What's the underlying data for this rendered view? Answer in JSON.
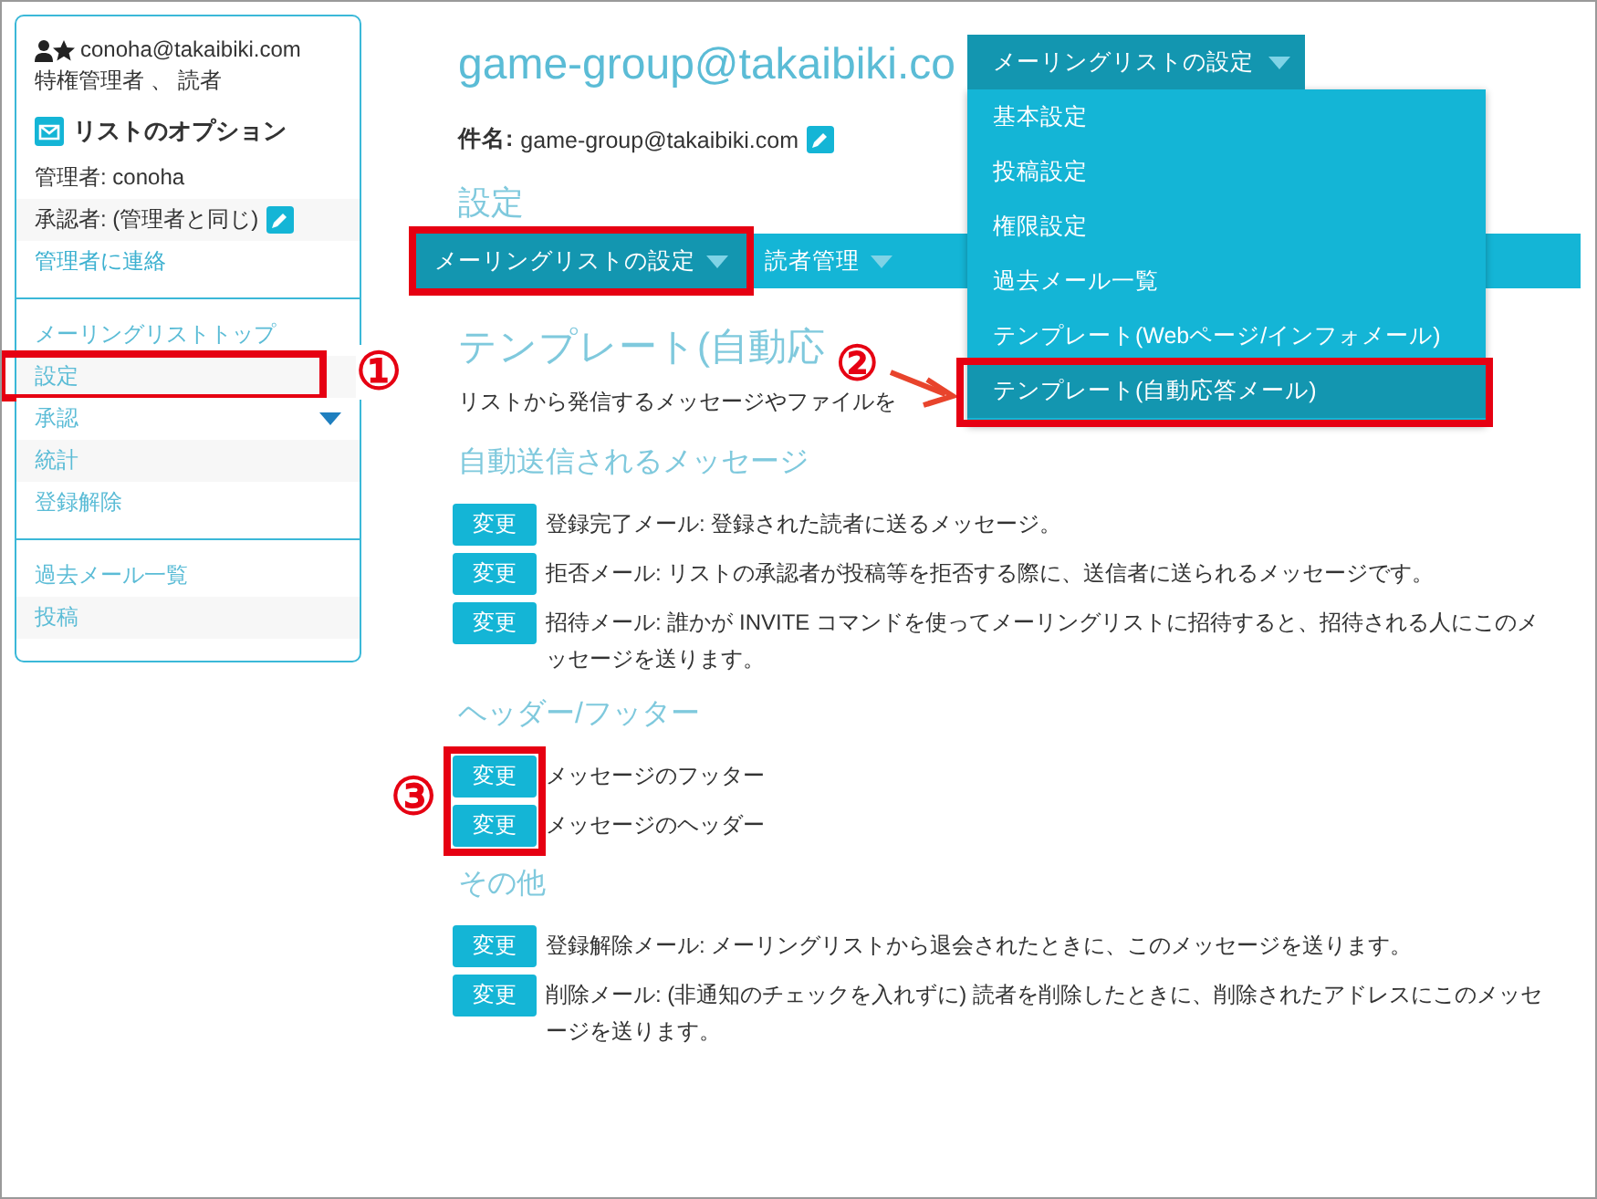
{
  "sidebar": {
    "user_email": "conoha@takaibiki.com",
    "user_roles": "特権管理者 、 読者",
    "options_title": "リストのオプション",
    "info": [
      {
        "kind": "text",
        "text": "管理者: conoha"
      },
      {
        "kind": "editable",
        "text": "承認者: (管理者と同じ)"
      },
      {
        "kind": "link",
        "text": "管理者に連絡"
      }
    ],
    "menus": [
      [
        {
          "label": "メーリングリストトップ",
          "highlighted": false,
          "has_submenu": false
        },
        {
          "label": "設定",
          "highlighted": true,
          "has_submenu": false
        },
        {
          "label": "承認",
          "highlighted": false,
          "has_submenu": true
        },
        {
          "label": "統計",
          "highlighted": false,
          "has_submenu": false
        },
        {
          "label": "登録解除",
          "highlighted": false,
          "has_submenu": false
        }
      ],
      [
        {
          "label": "過去メール一覧",
          "highlighted": false,
          "has_submenu": false
        },
        {
          "label": "投稿",
          "highlighted": false,
          "has_submenu": false
        }
      ]
    ]
  },
  "main": {
    "title": "game-group@takaibiki.co",
    "subject_label": "件名:",
    "subject_value": "game-group@takaibiki.com",
    "section": "設定",
    "nav": [
      {
        "label": "メーリングリストの設定",
        "selected": true,
        "highlighted": true,
        "has_caret": true
      },
      {
        "label": "読者管理",
        "selected": false,
        "highlighted": false,
        "has_caret": true
      }
    ],
    "dropdown": {
      "label": "メーリングリストの設定",
      "items": [
        {
          "label": "基本設定",
          "selected": false,
          "highlighted": false
        },
        {
          "label": "投稿設定",
          "selected": false,
          "highlighted": false
        },
        {
          "label": "権限設定",
          "selected": false,
          "highlighted": false
        },
        {
          "label": "過去メール一覧",
          "selected": false,
          "highlighted": false
        },
        {
          "label": "テンプレート(Webページ/インフォメール)",
          "selected": false,
          "highlighted": false
        },
        {
          "label": "テンプレート(自動応答メール)",
          "selected": true,
          "highlighted": true
        }
      ]
    },
    "page_heading": "テンプレート(自動応",
    "description": "リストから発信するメッセージやファイルを",
    "groups": [
      {
        "heading": "自動送信されるメッセージ",
        "highlighted": false,
        "rows": [
          {
            "button": "変更",
            "text": "登録完了メール: 登録された読者に送るメッセージ。"
          },
          {
            "button": "変更",
            "text": "拒否メール: リストの承認者が投稿等を拒否する際に、送信者に送られるメッセージです。"
          },
          {
            "button": "変更",
            "text": "招待メール: 誰かが INVITE コマンドを使ってメーリングリストに招待すると、招待される人にこのメッセージを送ります。"
          }
        ]
      },
      {
        "heading": "ヘッダー/フッター",
        "highlighted": true,
        "rows": [
          {
            "button": "変更",
            "text": "メッセージのフッター"
          },
          {
            "button": "変更",
            "text": "メッセージのヘッダー"
          }
        ]
      },
      {
        "heading": "その他",
        "highlighted": false,
        "rows": [
          {
            "button": "変更",
            "text": "登録解除メール: メーリングリストから退会されたときに、このメッセージを送ります。"
          },
          {
            "button": "変更",
            "text": "削除メール: (非通知のチェックを入れずに) 読者を削除したときに、削除されたアドレスにこのメッセージを送ります。"
          }
        ]
      }
    ]
  },
  "annotations": [
    "①",
    "②",
    "③"
  ]
}
